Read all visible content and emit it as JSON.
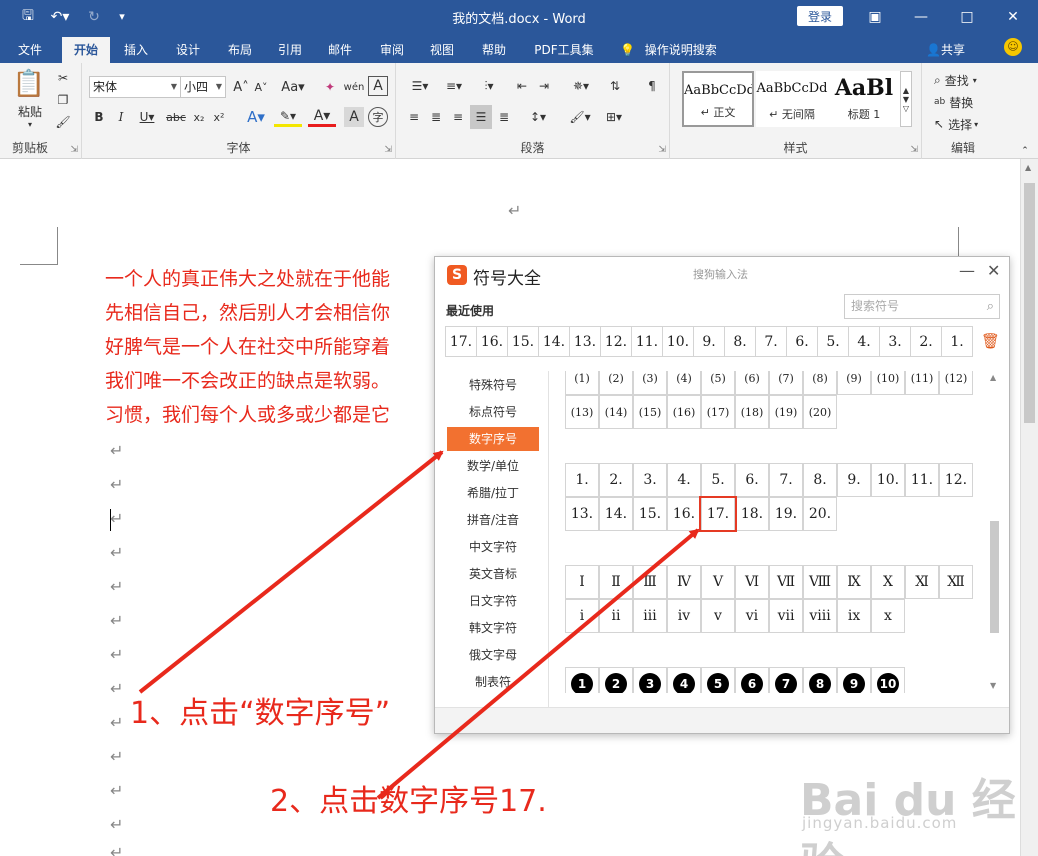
{
  "window": {
    "title": "我的文档.docx  -  Word",
    "login_label": "登录"
  },
  "tabs": [
    "文件",
    "开始",
    "插入",
    "设计",
    "布局",
    "引用",
    "邮件",
    "审阅",
    "视图",
    "帮助",
    "PDF工具集"
  ],
  "active_tab": "开始",
  "tell_me": "操作说明搜索",
  "share_label": "共享",
  "ribbon": {
    "clipboard": {
      "label": "剪贴板",
      "paste": "粘贴"
    },
    "font": {
      "label": "字体",
      "font_name": "宋体",
      "font_size": "小四"
    },
    "paragraph": {
      "label": "段落"
    },
    "styles": {
      "label": "样式",
      "items": [
        {
          "sample": "AaBbCcDd",
          "name": "↵ 正文"
        },
        {
          "sample": "AaBbCcDd",
          "name": "↵ 无间隔"
        },
        {
          "sample": "AaBl",
          "name": "标题 1"
        }
      ]
    },
    "editing": {
      "label": "编辑",
      "find": "查找",
      "replace": "替换",
      "select": "选择"
    }
  },
  "document": {
    "paragraph_mark": "↵",
    "lines": [
      "一个人的真正伟大之处就在于他能",
      "先相信自己，然后别人才会相信你",
      "好脾气是一个人在社交中所能穿着",
      "我们唯一不会改正的缺点是软弱。",
      "习惯，我们每个人或多或少都是它"
    ]
  },
  "dialog": {
    "title": "符号大全",
    "subtitle": "搜狗输入法",
    "logo": "S",
    "recent_label": "最近使用",
    "search_placeholder": "搜索符号",
    "recent_symbols": [
      "17.",
      "16.",
      "15.",
      "14.",
      "13.",
      "12.",
      "11.",
      "10.",
      "9.",
      "8.",
      "7.",
      "6.",
      "5.",
      "4.",
      "3.",
      "2.",
      "1."
    ],
    "categories": [
      "特殊符号",
      "标点符号",
      "数字序号",
      "数学/单位",
      "希腊/拉丁",
      "拼音/注音",
      "中文字符",
      "英文音标",
      "日文字符",
      "韩文字符",
      "俄文字母",
      "制表符"
    ],
    "active_category": "数字序号",
    "paren_row1": [
      "(1)",
      "(2)",
      "(3)",
      "(4)",
      "(5)",
      "(6)",
      "(7)",
      "(8)",
      "(9)",
      "(10)",
      "(11)",
      "(12)"
    ],
    "paren_row2": [
      "(13)",
      "(14)",
      "(15)",
      "(16)",
      "(17)",
      "(18)",
      "(19)",
      "(20)"
    ],
    "dot_row1": [
      "1.",
      "2.",
      "3.",
      "4.",
      "5.",
      "6.",
      "7.",
      "8.",
      "9.",
      "10.",
      "11.",
      "12."
    ],
    "dot_row2": [
      "13.",
      "14.",
      "15.",
      "16.",
      "17.",
      "18.",
      "19.",
      "20."
    ],
    "roman_upper": [
      "Ⅰ",
      "Ⅱ",
      "Ⅲ",
      "Ⅳ",
      "Ⅴ",
      "Ⅵ",
      "Ⅶ",
      "Ⅷ",
      "Ⅸ",
      "Ⅹ",
      "Ⅺ",
      "Ⅻ"
    ],
    "roman_lower": [
      "ⅰ",
      "ⅱ",
      "ⅲ",
      "ⅳ",
      "ⅴ",
      "ⅵ",
      "ⅶ",
      "ⅷ",
      "ⅸ",
      "ⅹ"
    ],
    "circled_neg": [
      "1",
      "2",
      "3",
      "4",
      "5",
      "6",
      "7",
      "8",
      "9",
      "10"
    ],
    "highlighted_symbol": "17."
  },
  "annotations": {
    "step1": "1、点击“数字序号”",
    "step2": "2、点击数字序号17.",
    "color": "#e8291c"
  },
  "watermark": {
    "main": "Bai du 经验",
    "sub": "jingyan.baidu.com"
  },
  "colors": {
    "word_blue": "#2b579a",
    "accent_orange": "#f27130",
    "text_red": "#e8291c"
  }
}
